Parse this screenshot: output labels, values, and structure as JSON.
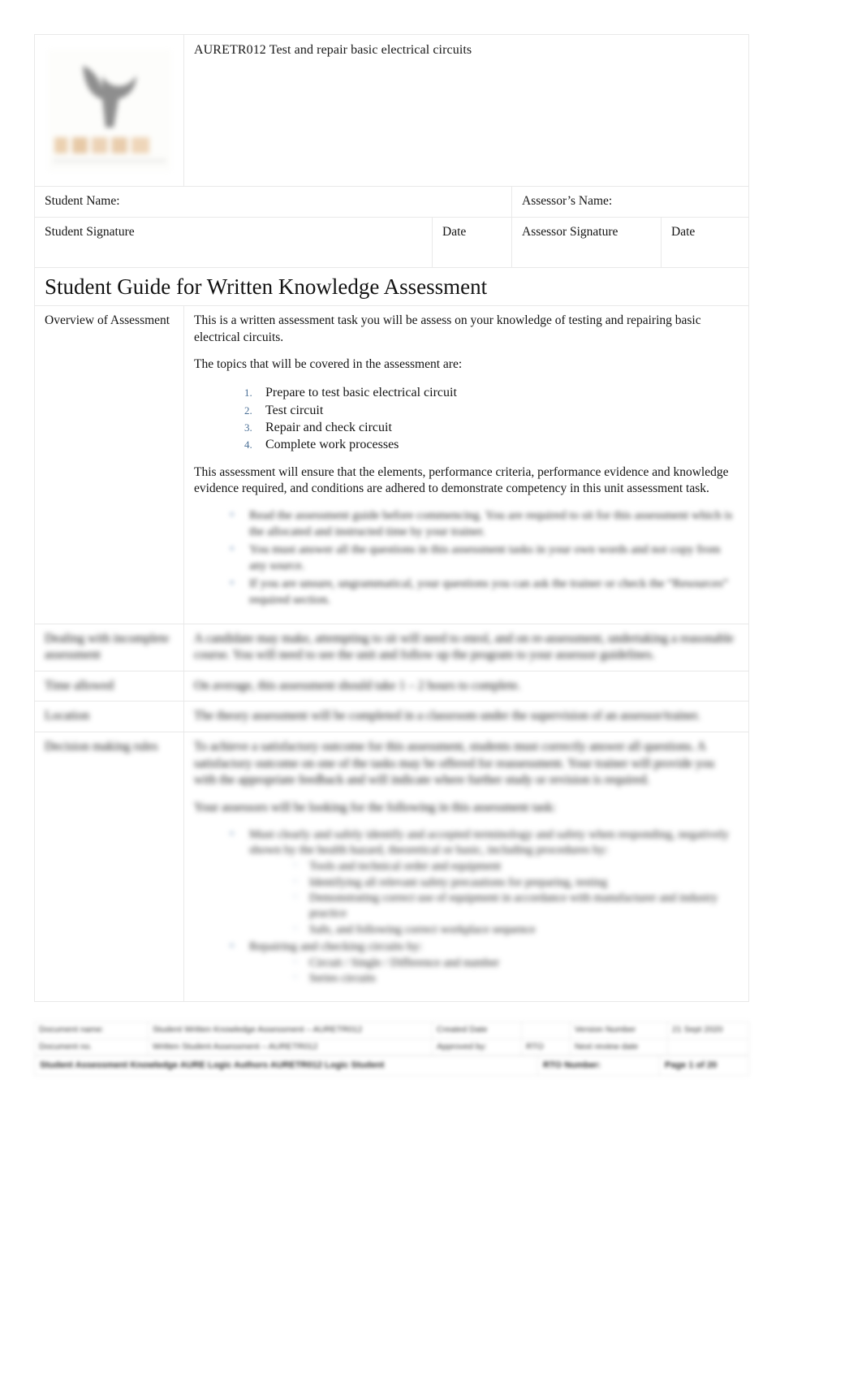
{
  "document": {
    "unit_title": "AURETR012 Test and repair basic electrical circuits",
    "logo_alt": "provider-logo"
  },
  "signature_block": {
    "student_name_label": "Student Name:",
    "assessor_name_label": "Assessor’s Name:",
    "student_signature_label": "Student Signature",
    "student_date_label": "Date",
    "assessor_signature_label": "Assessor Signature",
    "assessor_date_label": "Date"
  },
  "section": {
    "heading": "Student Guide for Written Knowledge Assessment"
  },
  "rows": {
    "overview": {
      "label": "Overview of Assessment",
      "para1": "This is a written assessment task you will be assess on your knowledge of testing and repairing basic electrical circuits.",
      "para2": "The topics that will be covered in the assessment are:",
      "topics": [
        "Prepare to test basic electrical circuit",
        "Test circuit",
        "Repair and check circuit",
        "Complete work processes"
      ],
      "para3": "This assessment will ensure that the elements, performance criteria, performance evidence and knowledge evidence required, and conditions are adhered to demonstrate competency in this unit assessment task.",
      "redacted_bullets": [
        "Read the assessment guide before commencing. You are required to sit for this assessment which is the allocated and instructed time by your trainer.",
        "You must answer all the questions in this assessment tasks in your own words and not copy from any source.",
        "If you are unsure, ungrammatical, your questions you can ask the trainer or check the “Resources” required section."
      ]
    },
    "dealing": {
      "label": "Dealing with incomplete assessment",
      "redacted": "A candidate may make, attempting to sit will need to enrol, and on re-assessment, undertaking a reasonable course. You will need to see the unit and follow up the program to your assessor guidelines."
    },
    "time": {
      "label": "Time allowed",
      "redacted": "On average, this assessment should take 1 – 2 hours to complete."
    },
    "location": {
      "label": "Location",
      "redacted": "The theory assessment will be completed in a classroom under the supervision of an assessor/trainer."
    },
    "decision": {
      "label": "Decision making rules",
      "redacted_para1": "To achieve a satisfactory outcome for this assessment, students must correctly answer all questions. A satisfactory outcome on one of the tasks may be offered for reassessment. Your trainer will provide you with the appropriate feedback and will indicate where further study or revision is required.",
      "redacted_para2": "Your assessors will be looking for the following in this assessment task:",
      "redacted_bullets": [
        {
          "text": "Must clearly and safely identify and accepted terminology and safety when responding, negatively shown by the health hazard, theoretical or basic, including procedures by:",
          "subs": [
            "Tools and technical order and equipment",
            "Identifying all relevant safety precautions for preparing, testing",
            "Demonstrating correct use of equipment in accordance with manufacturer and industry practice",
            "Safe, and following correct workplace sequence"
          ]
        },
        {
          "text": "Repairing and checking circuits by:",
          "subs": [
            "Circuit / Single / Difference and number",
            "Series circuits"
          ]
        }
      ]
    }
  },
  "footer": {
    "row1": {
      "c1": "Document name:",
      "c2": "Student Written Knowledge Assessment – AURETR012",
      "c3": "Created Date",
      "c4": "",
      "c5": "Version Number",
      "c6": "21 Sept 2020"
    },
    "row2": {
      "c1": "Document no.",
      "c2": "Written Student Assessment – AURETR012",
      "c3": "Approved by:",
      "c4": "RTO",
      "c5": "Next review date",
      "c6": ""
    },
    "row3": {
      "c1": "Student Assessment Knowledge AURE Logic Authors AURETR012 Logic Student",
      "c2": "RTO Number:",
      "c3": "Page 1 of 20"
    }
  }
}
